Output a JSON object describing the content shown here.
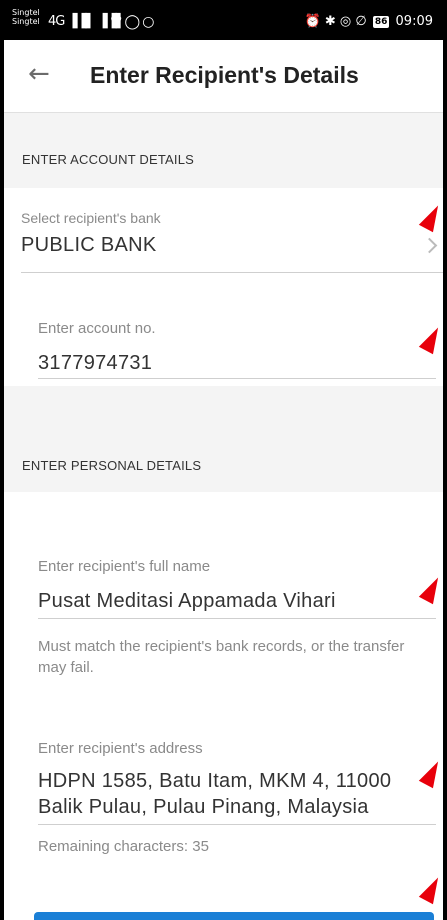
{
  "status_bar": {
    "carrier_1": "Singtel",
    "carrier_2": "Singtel",
    "network_icons": "4G ▐▐▌ ▐▐▌",
    "status_icons": "⏰ ✱ ◎ ∅",
    "battery": "86",
    "time": "09:09"
  },
  "header": {
    "title": "Enter Recipient's Details",
    "back_icon": "back-arrow-icon"
  },
  "account_section": {
    "heading": "ENTER ACCOUNT DETAILS",
    "bank": {
      "label": "Select recipient's bank",
      "value": "PUBLIC BANK"
    },
    "account": {
      "label": "Enter account no.",
      "value": "3177974731"
    }
  },
  "personal_section": {
    "heading": "ENTER PERSONAL DETAILS",
    "name": {
      "label": "Enter recipient's full name",
      "value": "Pusat Meditasi Appamada Vihari",
      "helper": "Must match the recipient's bank records, or the transfer may fail."
    },
    "address": {
      "label": "Enter recipient's address",
      "value_line1": "HDPN 1585, Batu Itam, MKM 4, 11000",
      "value_line2": "Balik Pulau, Pulau Pinang, Malaysia",
      "remaining": "Remaining characters: 35"
    }
  },
  "colors": {
    "accent": "#1a7fd6",
    "annotation_marker": "#e8000b",
    "background": "#f4f4f4"
  }
}
